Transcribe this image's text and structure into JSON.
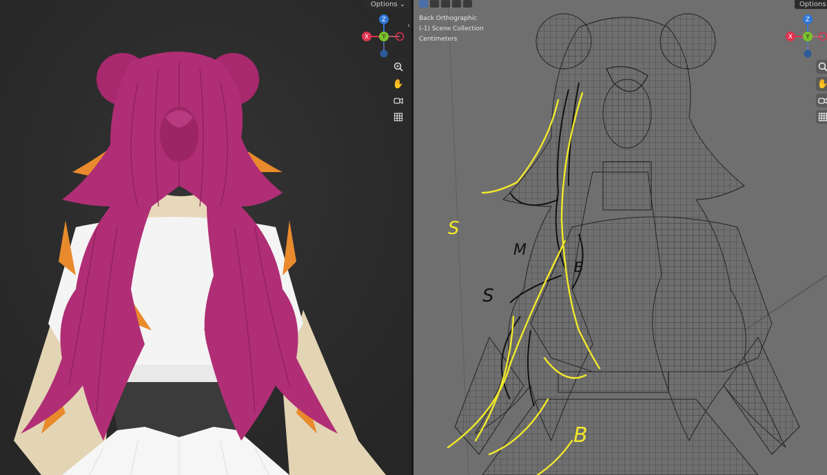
{
  "left_viewport": {
    "options_label": "Options",
    "options_arrow": "chevron-down-icon"
  },
  "right_viewport": {
    "options_label": "Options",
    "view_name": "Back Orthographic",
    "collection": "(-1) Scene Collection",
    "units": "Centimeters",
    "annotations": [
      "S",
      "M",
      "B",
      "S",
      "B"
    ]
  },
  "gizmo": {
    "z_label": "Z",
    "y_label": "Y",
    "x_label": "X",
    "colors": {
      "z": "#2e75d6",
      "y": "#7cc22c",
      "x": "#e0324f"
    }
  },
  "tools": [
    "zoom-icon",
    "pan-hand-icon",
    "camera-icon",
    "grid-icon"
  ],
  "colors": {
    "hair": "#b02e75",
    "hair_dark": "#8c1f5c",
    "hair_highlight": "#e98a2c",
    "skin": "#e6d8b8",
    "shirt": "#f4f4f4",
    "belt": "#3a3a3a",
    "annotation_yellow": "#f2ea2a",
    "wire": "#2e2e2e"
  }
}
